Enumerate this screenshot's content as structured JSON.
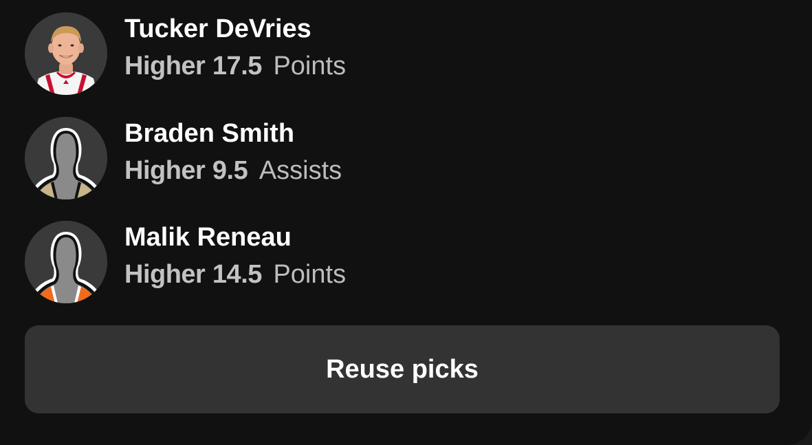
{
  "picks": [
    {
      "player": "Tucker DeVries",
      "direction": "Higher",
      "line": "17.5",
      "stat": "Points",
      "avatar_icon": "player-photo-icon",
      "jersey_color": "#c8102e"
    },
    {
      "player": "Braden Smith",
      "direction": "Higher",
      "line": "9.5",
      "stat": "Assists",
      "avatar_icon": "player-silhouette-icon",
      "jersey_color": "#c7b48a"
    },
    {
      "player": "Malik Reneau",
      "direction": "Higher",
      "line": "14.5",
      "stat": "Points",
      "avatar_icon": "player-silhouette-icon",
      "jersey_color": "#f26b1d"
    }
  ],
  "actions": {
    "reuse_label": "Reuse picks"
  },
  "colors": {
    "card_background": "#111111",
    "button_background": "#333333",
    "text_primary": "#ffffff",
    "text_secondary": "#c2c2c2"
  }
}
